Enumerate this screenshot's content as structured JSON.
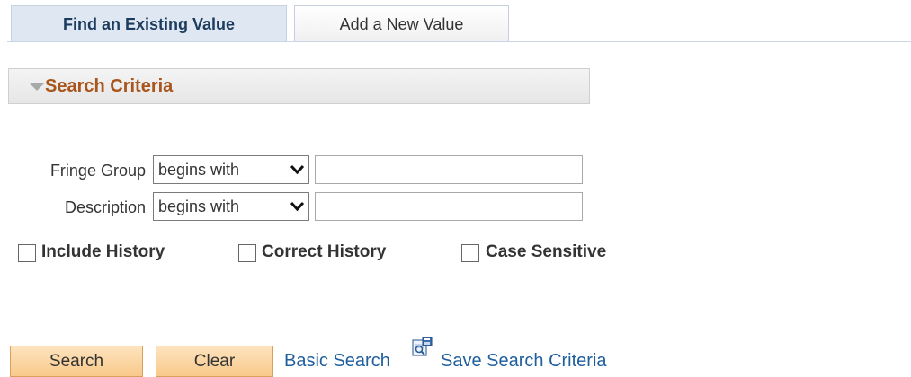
{
  "tabs": [
    {
      "label": "Find an Existing Value",
      "active": true
    },
    {
      "label_access_key": "A",
      "label_rest": "dd a New Value",
      "active": false
    }
  ],
  "section": {
    "title": "Search Criteria"
  },
  "fields": [
    {
      "label": "Fringe Group",
      "operator": "begins with",
      "value": ""
    },
    {
      "label": "Description",
      "operator": "begins with",
      "value": ""
    }
  ],
  "checkboxes": [
    {
      "label": "Include History",
      "checked": false
    },
    {
      "label": "Correct History",
      "checked": false
    },
    {
      "label": "Case Sensitive",
      "checked": false
    }
  ],
  "buttons": {
    "search": "Search",
    "clear": "Clear"
  },
  "links": {
    "basic_search": "Basic Search",
    "save_search_criteria": "Save Search Criteria"
  },
  "icons": {
    "save_search": "save-search-icon",
    "collapse": "triangle-down-icon",
    "dropdown": "chevron-down-icon"
  },
  "colors": {
    "section_title": "#a8561c",
    "link": "#1f5f9e",
    "button": "#f9c98a",
    "active_tab": "#dfe8f2"
  }
}
